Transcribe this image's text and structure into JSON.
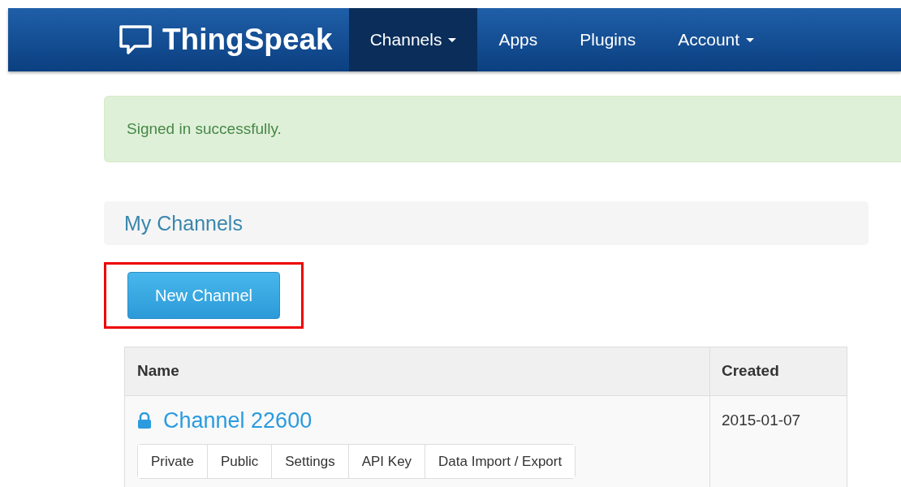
{
  "navbar": {
    "brand": "ThingSpeak",
    "items": [
      {
        "label": "Channels",
        "dropdown": true,
        "selected": true
      },
      {
        "label": "Apps",
        "dropdown": false,
        "selected": false
      },
      {
        "label": "Plugins",
        "dropdown": false,
        "selected": false
      },
      {
        "label": "Account",
        "dropdown": true,
        "selected": false
      }
    ]
  },
  "alert": {
    "text": "Signed in successfully."
  },
  "heading": "My Channels",
  "new_channel_button": {
    "label": "New Channel",
    "highlighted": true
  },
  "table": {
    "columns": [
      "Name",
      "Created"
    ],
    "rows": [
      {
        "name": "Channel 22600",
        "private": true,
        "created": "2015-01-07",
        "actions": [
          "Private",
          "Public",
          "Settings",
          "API Key",
          "Data Import / Export"
        ]
      }
    ]
  }
}
